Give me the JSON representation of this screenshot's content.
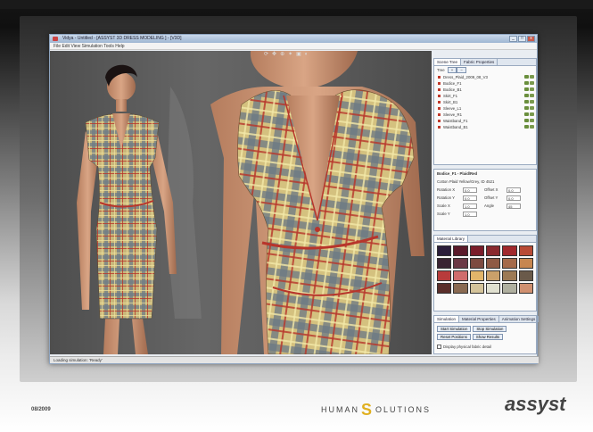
{
  "slide": {
    "date": "08/2009"
  },
  "window": {
    "title": "Vidya - Untitled - [ASSYST 3D  DRESS MODELING ] - [V3D]",
    "menu": "File  Edit  View  Simulation  Tools  Help",
    "controls": [
      "_",
      "□",
      "x"
    ]
  },
  "toolbar": {
    "icons": [
      "rotate-icon",
      "move-icon",
      "zoom-icon",
      "light-icon",
      "camera-icon",
      "render-icon"
    ]
  },
  "status_bar": {
    "text": "Loading simulation: 'Ready'"
  },
  "scene_panel": {
    "tabs": [
      "Scene Tree",
      "Fabric Properties"
    ],
    "active_tab": 0,
    "toolbar_label": "Tree",
    "items": [
      {
        "label": "Dress_Plaid_2009_08_V3",
        "selected": false
      },
      {
        "label": "Bodice_F1",
        "selected": false
      },
      {
        "label": "Bodice_B1",
        "selected": false
      },
      {
        "label": "Skirt_F1",
        "selected": false
      },
      {
        "label": "Skirt_B1",
        "selected": false
      },
      {
        "label": "Sleeve_L1",
        "selected": false
      },
      {
        "label": "Sleeve_R1",
        "selected": false
      },
      {
        "label": "Waistband_F1",
        "selected": false
      },
      {
        "label": "Waistband_B1",
        "selected": false
      }
    ]
  },
  "fabric_panel": {
    "title": "Bodice_F1 - Plaid/Red",
    "subtitle": "Cotton Plaid Yellow/Grey, ID 4521",
    "rows": [
      {
        "label": "Rotation X",
        "value": "0.0",
        "label2": "Offset X",
        "value2": "0.0"
      },
      {
        "label": "Rotation Y",
        "value": "0.0",
        "label2": "Offset Y",
        "value2": "0.0"
      },
      {
        "label": "Scale X",
        "value": "1.0",
        "label2": "Angle",
        "value2": "45"
      },
      {
        "label": "Scale Y",
        "value": "1.0",
        "label2": "",
        "value2": ""
      }
    ]
  },
  "material_panel": {
    "title": "Material Library",
    "swatch_colors": [
      "#2a1d3a",
      "#5a1a2a",
      "#7a1d2a",
      "#8a2a2f",
      "#a0282c",
      "#b84a35",
      "#3a2333",
      "#6b3844",
      "#7d4a40",
      "#8f5a45",
      "#a56a4a",
      "#c7864f",
      "#b83b3b",
      "#d06c6c",
      "#e2b56a",
      "#caa06a",
      "#9d7a55",
      "#6a5a4a",
      "#5a2e2a",
      "#8a6a52",
      "#d4c39a",
      "#e0e0d0",
      "#b0b0a0",
      "#d09070"
    ]
  },
  "action_panel": {
    "tabs": [
      "Simulation",
      "Material Properties",
      "Animation Settings"
    ],
    "buttons": [
      "Start Simulation",
      "Stop Simulation",
      "Reset Positions",
      "Show Results"
    ],
    "checkbox_label": "Display physical fabric detail"
  },
  "logos": {
    "human_left": "HUMAN",
    "human_right": "OLUTIONS",
    "assyst": "assyst"
  }
}
